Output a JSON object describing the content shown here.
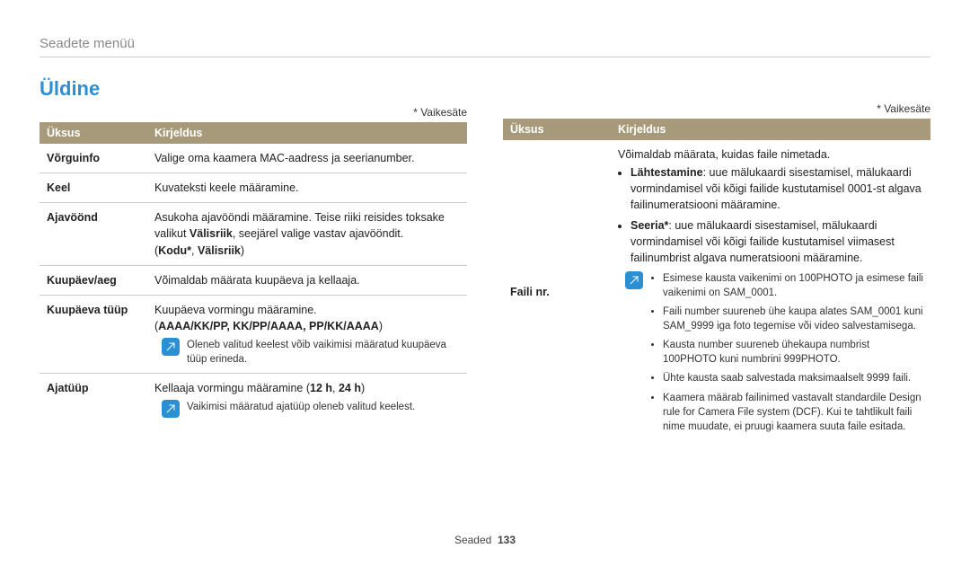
{
  "header": {
    "breadcrumb": "Seadete menüü"
  },
  "title": "Üldine",
  "default_note": "* Vaikesäte",
  "table_head": {
    "col1": "Üksus",
    "col2": "Kirjeldus"
  },
  "left": {
    "rows": [
      {
        "unit": "Võrguinfo",
        "desc": "Valige oma kaamera MAC-aadress ja seerianumber."
      },
      {
        "unit": "Keel",
        "desc": "Kuvateksti keele määramine."
      },
      {
        "unit": "Ajavöönd",
        "desc_pre": "Asukoha ajavööndi määramine. Teise riiki reisides toksake valikut ",
        "desc_bold1": "Välisriik",
        "desc_mid": ", seejärel valige vastav ajavööndit.",
        "desc_paren_open": "(",
        "desc_kodu": "Kodu*",
        "desc_sep": ", ",
        "desc_valis": "Välisriik",
        "desc_paren_close": ")"
      },
      {
        "unit": "Kuupäev/aeg",
        "desc": "Võimaldab määrata kuupäeva ja kellaaja."
      },
      {
        "unit": "Kuupäeva tüüp",
        "line1": "Kuupäeva vormingu määramine.",
        "line2_open": "(",
        "line2_formats": "AAAA/KK/PP, KK/PP/AAAA, PP/KK/AAAA",
        "line2_close": ")",
        "note": "Oleneb valitud keelest võib vaikimisi määratud kuupäeva tüüp erineda."
      },
      {
        "unit": "Ajatüüp",
        "line1_pre": "Kellaaja vormingu määramine (",
        "line1_b1": "12 h",
        "line1_mid": ", ",
        "line1_b2": "24 h",
        "line1_post": ")",
        "note": "Vaikimisi määratud ajatüüp oleneb valitud keelest."
      }
    ]
  },
  "right": {
    "row": {
      "unit": "Faili nr.",
      "intro": "Võimaldab määrata, kuidas faile nimetada.",
      "li1_b": "Lähtestamine",
      "li1_rest": ": uue mälukaardi sisestamisel, mälukaardi vormindamisel või kõigi failide kustutamisel 0001-st algava failinumeratsiooni määramine.",
      "li2_b": "Seeria*",
      "li2_rest": ": uue mälukaardi sisestamisel, mälukaardi vormindamisel või kõigi failide kustutamisel viimasest failinumbrist algava numeratsiooni määramine.",
      "notes": [
        "Esimese kausta vaikenimi on 100PHOTO ja esimese faili vaikenimi on SAM_0001.",
        "Faili number suureneb ühe kaupa alates SAM_0001 kuni SAM_9999 iga foto tegemise või video salvestamisega.",
        "Kausta number suureneb ühekaupa numbrist 100PHOTO kuni numbrini 999PHOTO.",
        "Ühte kausta saab salvestada maksimaalselt 9999 faili.",
        "Kaamera määrab failinimed vastavalt standardile Design rule for Camera File system (DCF). Kui te tahtlikult faili nime muudate, ei pruugi kaamera suuta faile esitada."
      ]
    }
  },
  "footer": {
    "label": "Seaded",
    "page": "133"
  }
}
